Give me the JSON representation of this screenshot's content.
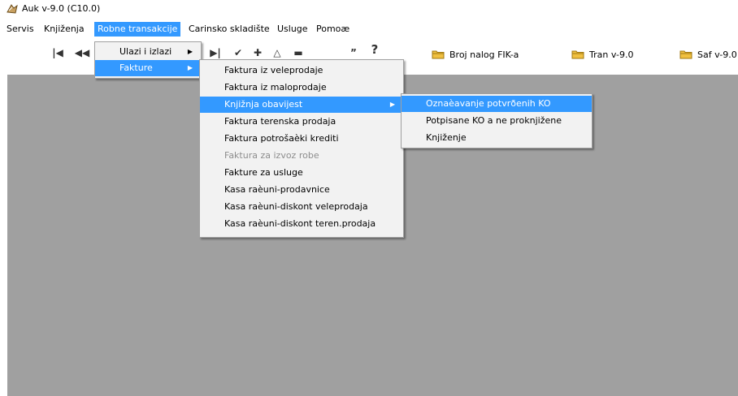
{
  "window": {
    "title": "Auk v-9.0 (C10.0)"
  },
  "menubar": [
    {
      "label": "Servis",
      "active": false
    },
    {
      "label": "Knjiženja",
      "active": false
    },
    {
      "label": "Robne transakcije",
      "active": true
    },
    {
      "label": "Carinsko skladište",
      "active": false
    },
    {
      "label": "Usluge",
      "active": false
    },
    {
      "label": "Pomoæ",
      "active": false
    }
  ],
  "toolbar": {
    "nav_icons": [
      "first-record-icon",
      "previous-record-icon",
      "last-record-icon",
      "check-icon",
      "plus-icon",
      "triangle-icon",
      "minus-icon",
      "quote-icon",
      "help-icon"
    ],
    "buttons": [
      {
        "label": "Broj nalog FIK-a",
        "icon": "folder-icon"
      },
      {
        "label": "Tran v-9.0",
        "icon": "folder-icon"
      },
      {
        "label": "Saf v-9.0",
        "icon": "folder-icon"
      }
    ]
  },
  "menu1": {
    "items": [
      {
        "label": "Ulazi i izlazi",
        "submenu": true,
        "active": false
      },
      {
        "label": "Fakture",
        "submenu": true,
        "active": true
      }
    ]
  },
  "menu2": {
    "items": [
      {
        "label": "Faktura iz veleprodaje",
        "active": false,
        "disabled": false
      },
      {
        "label": "Faktura iz maloprodaje",
        "active": false,
        "disabled": false
      },
      {
        "label": "Knjižnja obavijest",
        "active": true,
        "disabled": false,
        "submenu": true
      },
      {
        "label": "Faktura terenska prodaja",
        "active": false,
        "disabled": false
      },
      {
        "label": "Faktura potrošaèki krediti",
        "active": false,
        "disabled": false
      },
      {
        "label": "Faktura za izvoz robe",
        "active": false,
        "disabled": true
      },
      {
        "label": "Fakture za usluge",
        "active": false,
        "disabled": false
      },
      {
        "label": "Kasa raèuni-prodavnice",
        "active": false,
        "disabled": false
      },
      {
        "label": "Kasa raèuni-diskont veleprodaja",
        "active": false,
        "disabled": false
      },
      {
        "label": "Kasa raèuni-diskont teren.prodaja",
        "active": false,
        "disabled": false
      }
    ]
  },
  "menu3": {
    "items": [
      {
        "label": "Oznaèavanje potvrðenih KO",
        "active": true
      },
      {
        "label": "Potpisane KO a ne proknjižene",
        "active": false
      },
      {
        "label": "Knjiženje",
        "active": false
      }
    ]
  },
  "colors": {
    "highlight": "#3399ff",
    "workspace": "#a0a0a0",
    "menu_bg": "#f2f2f2",
    "disabled_text": "#8d8d8d"
  }
}
